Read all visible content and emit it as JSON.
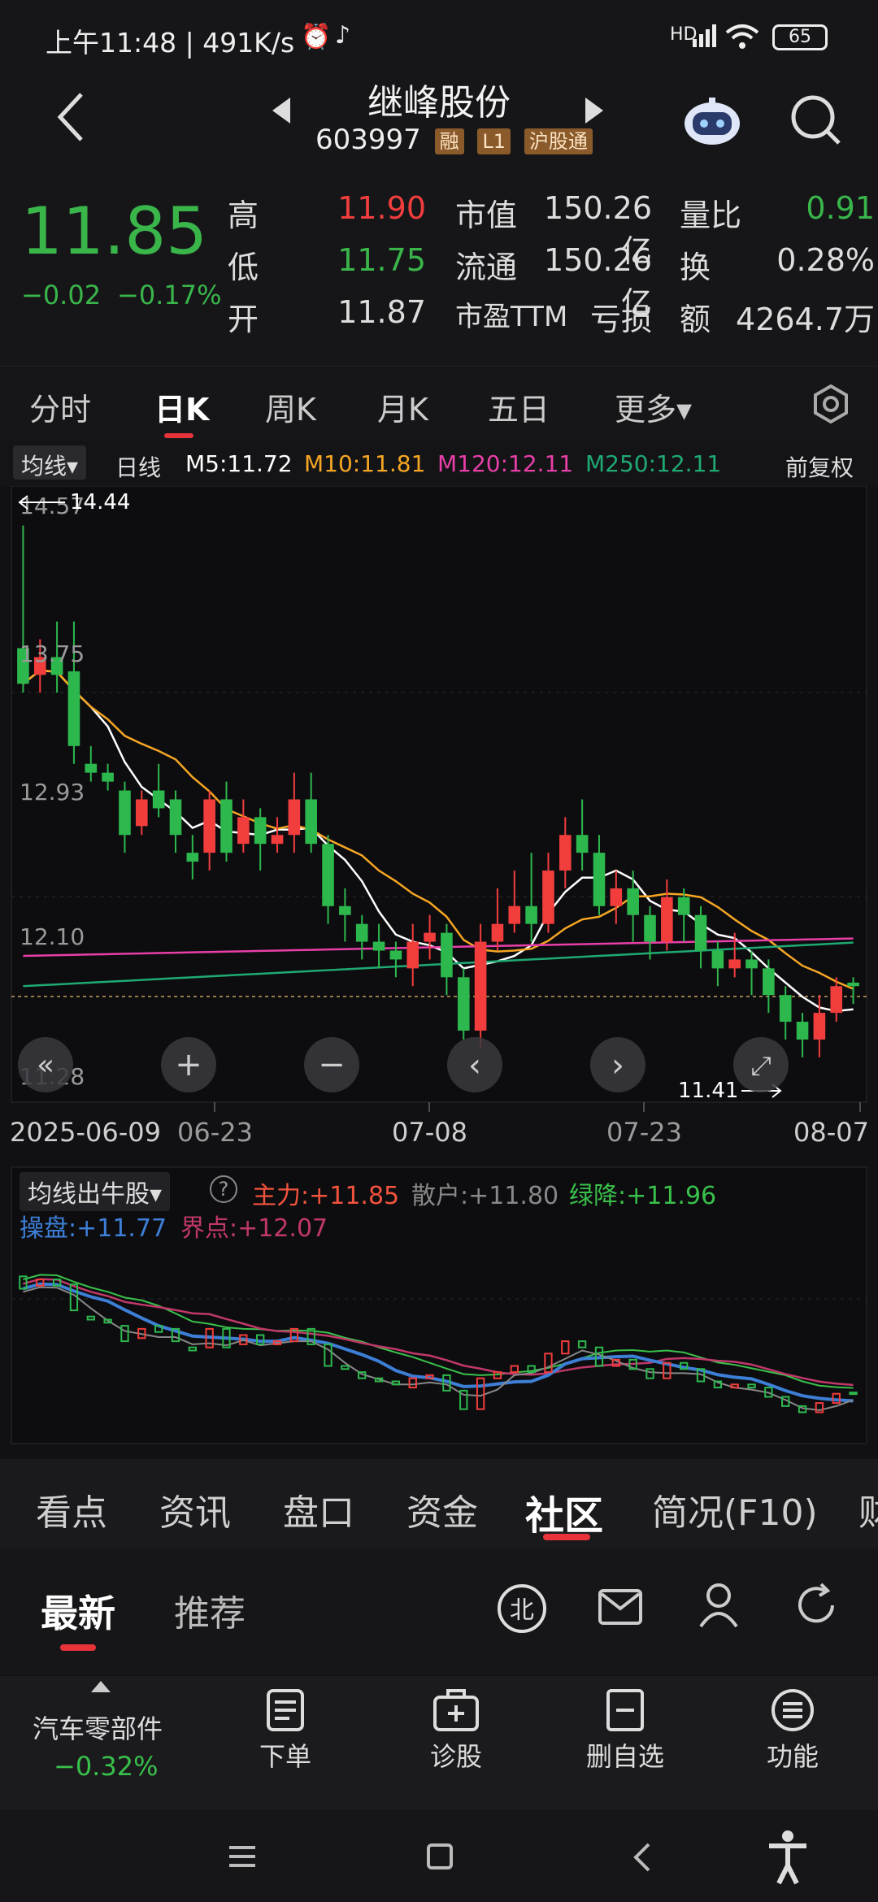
{
  "status": {
    "time": "上午11:48 | 491K/s",
    "battery": "65",
    "net": "HD"
  },
  "header": {
    "title": "继峰股份",
    "code": "603997",
    "tags": [
      "融",
      "L1",
      "沪股通"
    ]
  },
  "quote": {
    "price": "11.85",
    "change": "−0.02",
    "change_pct": "−0.17%",
    "high_label": "高",
    "high": "11.90",
    "low_label": "低",
    "low": "11.75",
    "open_label": "开",
    "open": "11.87",
    "mcap_label": "市值",
    "mcap": "150.26亿",
    "float_label": "流通",
    "float": "150.26亿",
    "pe_label": "市盈TTM",
    "pe": "亏损",
    "vr_label": "量比",
    "vr": "0.91",
    "turn_label": "换",
    "turn": "0.28%",
    "amt_label": "额",
    "amt": "4264.7万"
  },
  "period_tabs": [
    "分时",
    "日K",
    "周K",
    "月K",
    "五日",
    "更多▾"
  ],
  "ma_legend": {
    "indicator": "均线▾",
    "period": "日线",
    "m5": "M5:11.72",
    "m10": "M10:11.81",
    "m120": "M120:12.11",
    "m250": "M250:12.11",
    "adjust": "前复权"
  },
  "colors": {
    "up": "#f23d3d",
    "down": "#2db84d",
    "m5": "#ffffff",
    "m10": "#f6a623",
    "m120": "#e83fa8",
    "m250": "#1faa73"
  },
  "price_axis": {
    "labels": [
      "14.57",
      "13.75",
      "12.93",
      "12.10",
      "11.28"
    ],
    "high_mark": "14.44",
    "low_mark": "11.41"
  },
  "date_axis": [
    "2025-06-09",
    "06-23",
    "07-08",
    "07-23",
    "08-07"
  ],
  "chart_data": {
    "type": "candlestick",
    "ylim": [
      11.28,
      14.57
    ],
    "candles": [
      [
        13.75,
        13.55,
        14.44,
        13.5
      ],
      [
        13.6,
        13.7,
        13.8,
        13.5
      ],
      [
        13.7,
        13.6,
        13.9,
        13.5
      ],
      [
        13.62,
        13.2,
        13.9,
        13.1
      ],
      [
        13.1,
        13.05,
        13.2,
        13.0
      ],
      [
        13.05,
        13.0,
        13.1,
        12.95
      ],
      [
        12.95,
        12.7,
        13.0,
        12.6
      ],
      [
        12.75,
        12.9,
        12.95,
        12.7
      ],
      [
        12.95,
        12.85,
        13.1,
        12.8
      ],
      [
        12.9,
        12.7,
        12.95,
        12.6
      ],
      [
        12.6,
        12.55,
        12.7,
        12.45
      ],
      [
        12.6,
        12.9,
        12.95,
        12.5
      ],
      [
        12.9,
        12.6,
        13.0,
        12.55
      ],
      [
        12.65,
        12.8,
        12.9,
        12.6
      ],
      [
        12.8,
        12.65,
        12.85,
        12.5
      ],
      [
        12.65,
        12.7,
        12.8,
        12.6
      ],
      [
        12.7,
        12.9,
        13.05,
        12.6
      ],
      [
        12.9,
        12.65,
        13.05,
        12.6
      ],
      [
        12.65,
        12.3,
        12.7,
        12.2
      ],
      [
        12.3,
        12.25,
        12.4,
        12.1
      ],
      [
        12.2,
        12.1,
        12.25,
        12.0
      ],
      [
        12.1,
        12.05,
        12.2,
        11.95
      ],
      [
        12.05,
        12.0,
        12.1,
        11.9
      ],
      [
        11.95,
        12.1,
        12.2,
        11.85
      ],
      [
        12.1,
        12.15,
        12.25,
        12.0
      ],
      [
        12.15,
        11.9,
        12.2,
        11.8
      ],
      [
        11.9,
        11.6,
        11.95,
        11.55
      ],
      [
        11.6,
        12.1,
        12.2,
        11.5
      ],
      [
        12.1,
        12.2,
        12.4,
        12.05
      ],
      [
        12.2,
        12.3,
        12.5,
        12.15
      ],
      [
        12.3,
        12.2,
        12.6,
        12.1
      ],
      [
        12.2,
        12.5,
        12.6,
        12.15
      ],
      [
        12.5,
        12.7,
        12.8,
        12.4
      ],
      [
        12.7,
        12.6,
        12.9,
        12.5
      ],
      [
        12.6,
        12.3,
        12.7,
        12.25
      ],
      [
        12.3,
        12.4,
        12.5,
        12.2
      ],
      [
        12.4,
        12.25,
        12.5,
        12.1
      ],
      [
        12.25,
        12.1,
        12.3,
        12.0
      ],
      [
        12.1,
        12.35,
        12.45,
        12.05
      ],
      [
        12.35,
        12.25,
        12.4,
        12.1
      ],
      [
        12.25,
        12.05,
        12.3,
        11.95
      ],
      [
        12.05,
        11.95,
        12.1,
        11.85
      ],
      [
        11.95,
        12.0,
        12.15,
        11.9
      ],
      [
        12.0,
        11.95,
        12.05,
        11.8
      ],
      [
        11.95,
        11.8,
        12.0,
        11.7
      ],
      [
        11.8,
        11.65,
        11.85,
        11.55
      ],
      [
        11.65,
        11.55,
        11.7,
        11.45
      ],
      [
        11.55,
        11.7,
        11.8,
        11.45
      ],
      [
        11.7,
        11.85,
        11.9,
        11.65
      ],
      [
        11.87,
        11.85,
        11.9,
        11.75
      ]
    ]
  },
  "zoom_controls": [
    "«",
    "+",
    "−",
    "‹",
    "›",
    "⤢"
  ],
  "sub_indicator": {
    "name": "均线出牛股▾",
    "help": "?",
    "main_force": "主力:+11.85",
    "retail": "散户:+11.80",
    "green_fall": "绿降:+11.96",
    "operate": "操盘:+11.77",
    "boundary": "界点:+12.07"
  },
  "section_tabs": [
    "看点",
    "资讯",
    "盘口",
    "资金",
    "社区",
    "简况(F10)",
    "财"
  ],
  "community_tabs": [
    "最新",
    "推荐"
  ],
  "bottom": {
    "sector": "汽车零部件",
    "sector_chg": "−0.32%",
    "buttons": [
      "下单",
      "诊股",
      "删自选",
      "功能"
    ]
  },
  "icons": [
    "back-icon",
    "robot-icon",
    "search-icon",
    "settings-icon",
    "mail-icon",
    "user-icon",
    "refresh-icon"
  ]
}
